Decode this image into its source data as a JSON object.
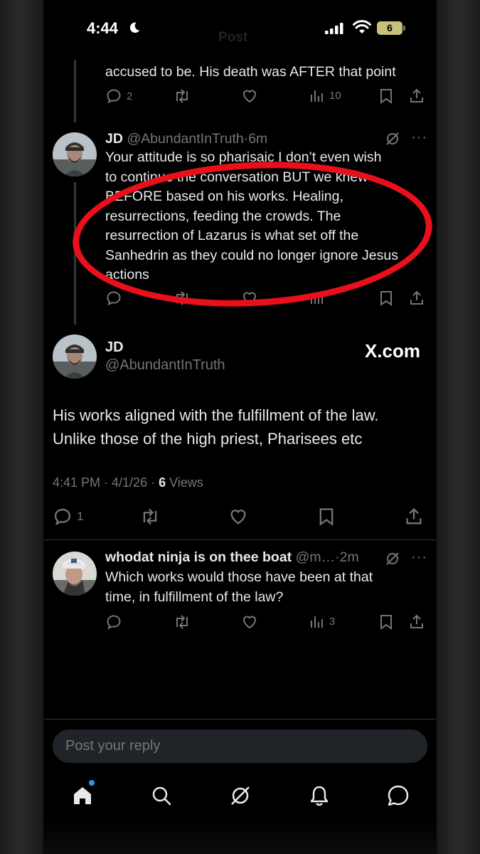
{
  "status_bar": {
    "time": "4:44",
    "battery": "6"
  },
  "header": {
    "title": "Post"
  },
  "thread_top": {
    "text_fragment": "accused to be. His death was AFTER that point",
    "replies": "2",
    "views": "10"
  },
  "reply_jd": {
    "name": "JD",
    "handle": "@AbundantInTruth",
    "time": "6m",
    "lines": [
      "Your attitude is so pharisaic I don’t even wish",
      "to continue the conversation BUT we knew",
      "BEFORE based on his works. Healing,",
      "resurrections, feeding the crowds. The",
      "resurrection of Lazarus is what set off the",
      "Sanhedrin as they could no longer ignore Jesus",
      "actions"
    ],
    "more": "···"
  },
  "main_post": {
    "name": "JD",
    "handle": "@AbundantInTruth",
    "watermark": "X.com",
    "text_line1": "His works aligned with the fulfillment of the law.",
    "text_line2": "Unlike those of the high priest, Pharisees etc",
    "timestamp": "4:41 PM · 4/1/26 · ",
    "views_count": "6",
    "views_label": " Views",
    "replies": "1"
  },
  "reply_whodat": {
    "name": "whodat ninja is on thee boat",
    "handle": "@m…",
    "time": "2m",
    "line1": "Which works would those have been at that",
    "line2": "time, in fulfillment of the law?",
    "views": "3",
    "more": "···"
  },
  "composer": {
    "placeholder": "Post your reply"
  },
  "colors": {
    "accent": "#1d9bf0",
    "annotation": "#e8101a",
    "muted": "#71767b",
    "text": "#e7e9ea"
  },
  "tab_icons": [
    "home-icon",
    "search-icon",
    "grok-icon",
    "notifications-icon",
    "messages-icon"
  ]
}
